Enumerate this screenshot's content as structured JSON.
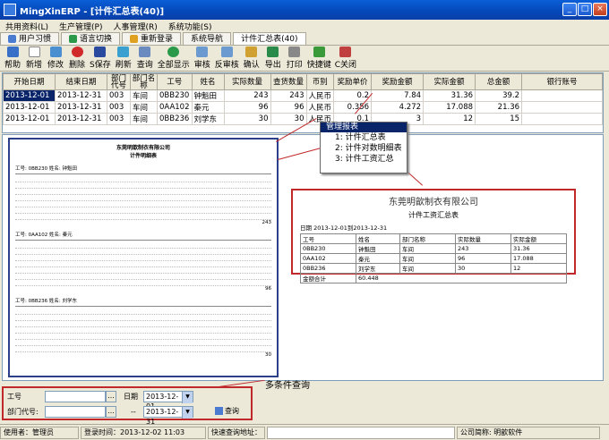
{
  "window": {
    "title": "MingXinERP - [计件汇总表(40)]"
  },
  "menu": [
    "共用资料(L)",
    "生产管理(P)",
    "人事管理(R)",
    "系统功能(S)"
  ],
  "tabs": [
    "用户习惯",
    "语言切换",
    "重新登录",
    "系统导航",
    "计件汇总表(40)"
  ],
  "toolbar": [
    "帮助",
    "新增",
    "修改",
    "删除",
    "S保存",
    "刷新",
    "查询",
    "全部显示",
    "审核",
    "反审核",
    "确认",
    "导出",
    "打印",
    "快捷键",
    "C关闭"
  ],
  "grid": {
    "headers": [
      "开始日期",
      "结束日期",
      "部门代号",
      "部门名称",
      "工号",
      "姓名",
      "实际数量",
      "查货数量",
      "币别",
      "奖励单价",
      "奖励金额",
      "实际金额",
      "总金额",
      "银行账号"
    ],
    "rows": [
      [
        "2013-12-01",
        "2013-12-31",
        "003",
        "车间",
        "0BB230",
        "钟魁田",
        "243",
        "243",
        "人民币",
        "0.2",
        "7.84",
        "31.36",
        "39.2",
        ""
      ],
      [
        "2013-12-01",
        "2013-12-31",
        "003",
        "车间",
        "0AA102",
        "秦元",
        "96",
        "96",
        "人民币",
        "0.356",
        "4.272",
        "17.088",
        "21.36",
        ""
      ],
      [
        "2013-12-01",
        "2013-12-31",
        "003",
        "车间",
        "0BB236",
        "刘学东",
        "30",
        "30",
        "人民币",
        "0.1",
        "3",
        "12",
        "15",
        ""
      ]
    ]
  },
  "popup": {
    "title": "管理报表",
    "items": [
      "1: 计件汇总表",
      "2: 计件对数明细表",
      "3: 计件工资汇总"
    ]
  },
  "report": {
    "company": "东莞明歆制衣有限公司",
    "subtitle": "计件明细表",
    "sections": [
      {
        "emp": "工号: 0BB230  姓名: 钟魁田",
        "count": "243"
      },
      {
        "emp": "工号: 0AA102  姓名: 秦元",
        "count": "96"
      },
      {
        "emp": "工号: 0BB236  姓名: 刘学东",
        "count": "30"
      }
    ]
  },
  "summary": {
    "company": "东莞明歆制衣有限公司",
    "title": "计件工资汇总表",
    "date": "日期 2013-12-01到2013-12-31",
    "headers": [
      "工号",
      "姓名",
      "部门名称",
      "实际数量",
      "实际金额"
    ],
    "rows": [
      [
        "0BB230",
        "钟魁田",
        "车间",
        "243",
        "31.36"
      ],
      [
        "0AA102",
        "秦元",
        "车间",
        "96",
        "17.088"
      ],
      [
        "0BB236",
        "刘学东",
        "车间",
        "30",
        "12"
      ]
    ],
    "total_label": "金额合计",
    "total": "60.448"
  },
  "query": {
    "note": "多条件查询",
    "emp_label": "工号",
    "dept_label": "部门代号:",
    "date_label": "日期",
    "from": "2013-12-01",
    "to_sep": "--",
    "to": "2013-12-31",
    "btn": "查询"
  },
  "status": {
    "user": "使用者：管理员",
    "login": "登录时间：2013-12-02 11:03",
    "quick": "快速查询地址：",
    "company": "公司简称: 明歆软件"
  }
}
